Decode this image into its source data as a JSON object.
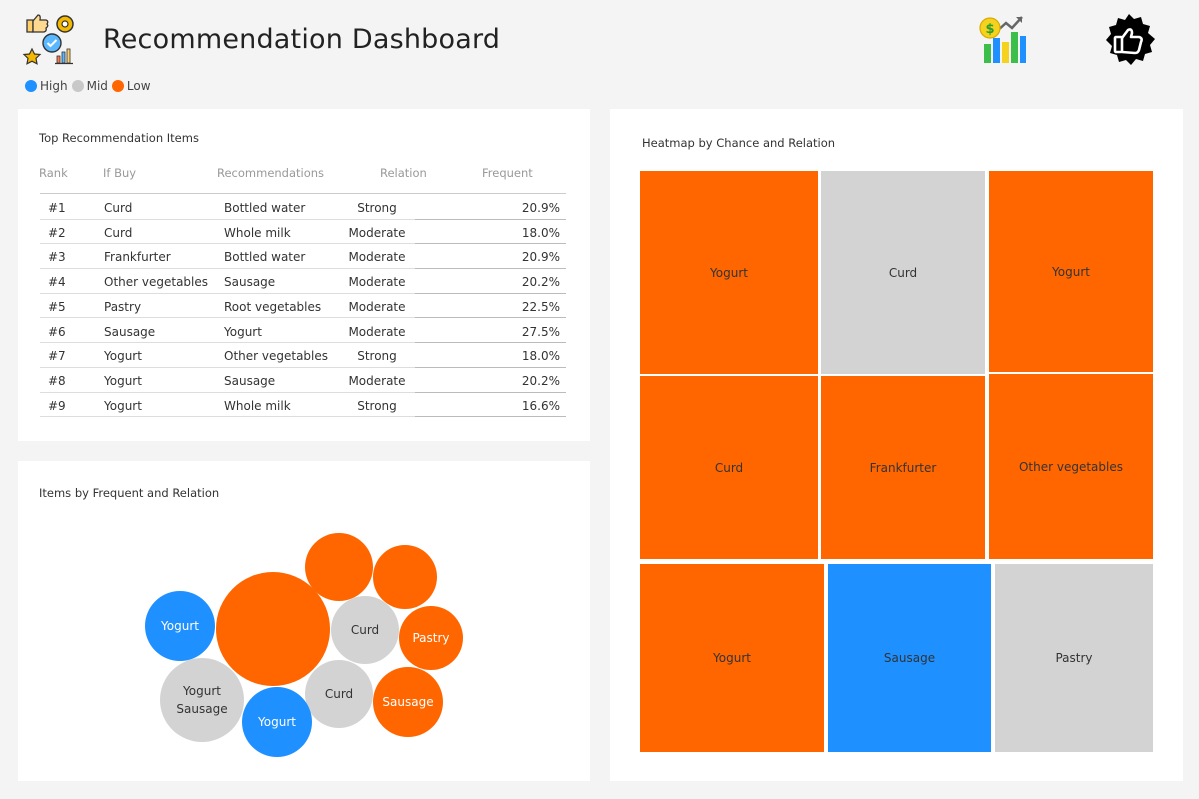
{
  "header": {
    "title": "Recommendation Dashboard",
    "logo_icon": "thumbs-up-gear-star-icon",
    "money_icon": "money-chart-icon",
    "like_icon": "like-badge-icon"
  },
  "legend": [
    {
      "label": "High",
      "color": "#1e90ff"
    },
    {
      "label": "Mid",
      "color": "#c8c8c8"
    },
    {
      "label": "Low",
      "color": "#ff6600"
    }
  ],
  "table": {
    "title": "Top Recommendation Items",
    "columns": [
      "Rank",
      "If Buy",
      "Recommendations",
      "Relation",
      "Frequent"
    ],
    "rows": [
      {
        "rank": "#1",
        "if_buy": "Curd",
        "rec": "Bottled water",
        "relation": "Strong",
        "freq": "20.9%"
      },
      {
        "rank": "#2",
        "if_buy": "Curd",
        "rec": "Whole milk",
        "relation": "Moderate",
        "freq": "18.0%"
      },
      {
        "rank": "#3",
        "if_buy": "Frankfurter",
        "rec": "Bottled water",
        "relation": "Moderate",
        "freq": "20.9%"
      },
      {
        "rank": "#4",
        "if_buy": "Other vegetables",
        "rec": "Sausage",
        "relation": "Moderate",
        "freq": "20.2%"
      },
      {
        "rank": "#5",
        "if_buy": "Pastry",
        "rec": "Root vegetables",
        "relation": "Moderate",
        "freq": "22.5%"
      },
      {
        "rank": "#6",
        "if_buy": "Sausage",
        "rec": "Yogurt",
        "relation": "Moderate",
        "freq": "27.5%"
      },
      {
        "rank": "#7",
        "if_buy": "Yogurt",
        "rec": "Other vegetables",
        "relation": "Strong",
        "freq": "18.0%"
      },
      {
        "rank": "#8",
        "if_buy": "Yogurt",
        "rec": "Sausage",
        "relation": "Moderate",
        "freq": "20.2%"
      },
      {
        "rank": "#9",
        "if_buy": "Yogurt",
        "rec": "Whole milk",
        "relation": "Strong",
        "freq": "16.6%"
      }
    ]
  },
  "bubble_chart": {
    "title": "Items by Frequent and Relation",
    "bubbles": [
      {
        "label": "",
        "level": "Low"
      },
      {
        "label": "",
        "level": "Low"
      },
      {
        "label": "",
        "level": "Low"
      },
      {
        "label": "Yogurt",
        "level": "High"
      },
      {
        "label": "Curd",
        "level": "Mid"
      },
      {
        "label": "Pastry",
        "level": "Low"
      },
      {
        "label": "Yogurt\nSausage",
        "level": "Mid"
      },
      {
        "label": "Curd",
        "level": "Mid"
      },
      {
        "label": "Sausage",
        "level": "Low"
      },
      {
        "label": "Yogurt",
        "level": "High"
      }
    ]
  },
  "heatmap": {
    "title": "Heatmap by Chance and Relation",
    "tiles": [
      {
        "label": "Yogurt",
        "level": "Low"
      },
      {
        "label": "Curd",
        "level": "Mid"
      },
      {
        "label": "Yogurt",
        "level": "Low"
      },
      {
        "label": "Curd",
        "level": "Low"
      },
      {
        "label": "Frankfurter",
        "level": "Low"
      },
      {
        "label": "Other vegetables",
        "level": "Low"
      },
      {
        "label": "Yogurt",
        "level": "Low"
      },
      {
        "label": "Sausage",
        "level": "High"
      },
      {
        "label": "Pastry",
        "level": "Mid"
      }
    ]
  }
}
